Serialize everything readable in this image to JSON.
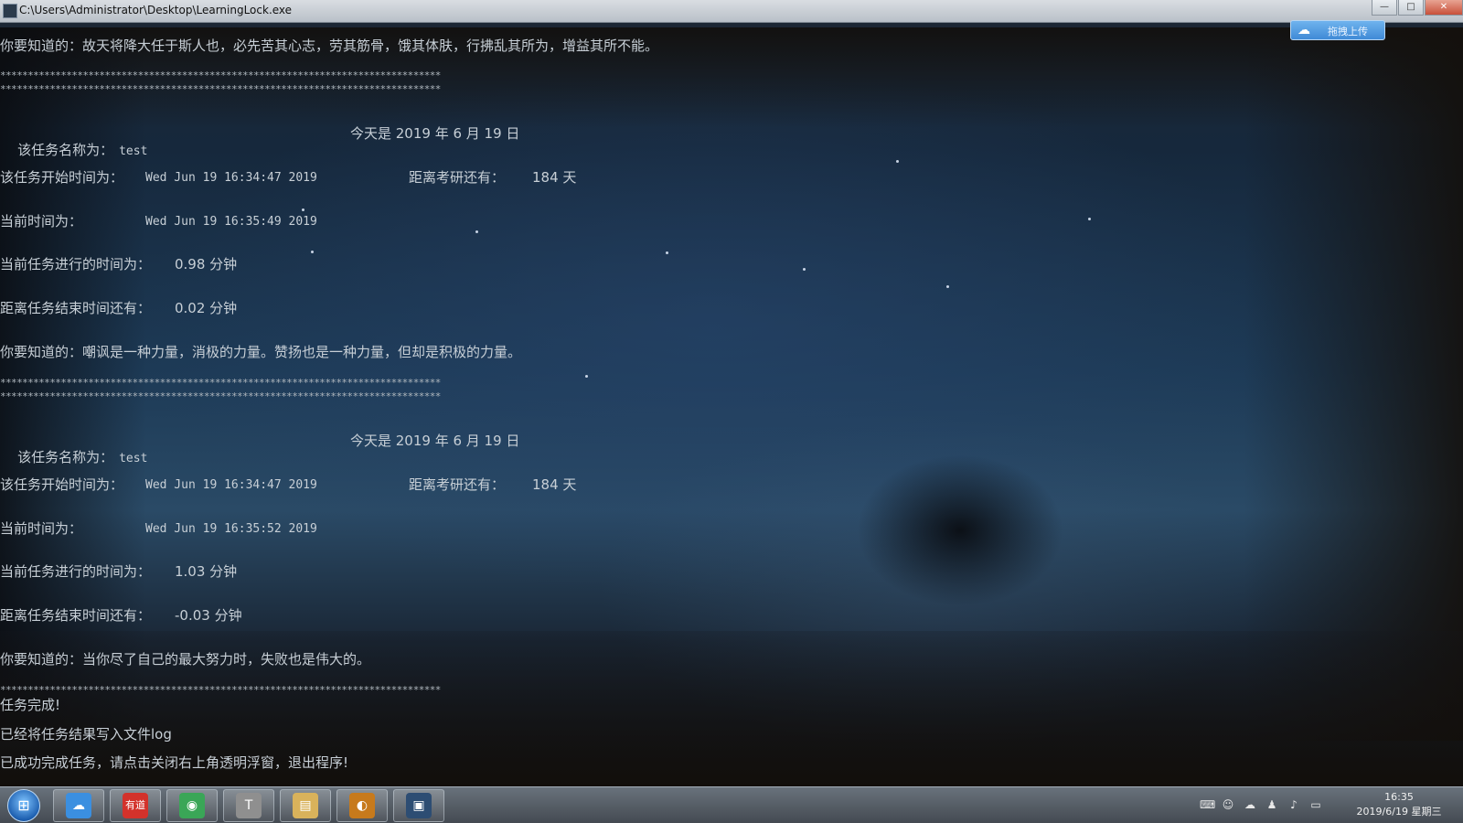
{
  "window": {
    "title": "C:\\Users\\Administrator\\Desktop\\LearningLock.exe",
    "buttons": {
      "minimize": "—",
      "maximize": "□",
      "close": "✕"
    }
  },
  "upload_widget": {
    "label": "拖拽上传",
    "icon": "cloud-icon"
  },
  "console": {
    "motto1": "你要知道的：故天将降大任于斯人也，必先苦其心志，劳其筋骨，饿其体肤，行拂乱其所为，增益其所不能。",
    "stars": "********************************************************************************",
    "block1": {
      "task_name_label": "该任务名称为：",
      "task_name": "test",
      "today_label": "今天是 2019 年 6 月 19 日",
      "start_label": "该任务开始时间为：",
      "start_value": "Wed Jun 19 16:34:47 2019",
      "exam_label": "距离考研还有：",
      "exam_value": "184 天",
      "now_label": "当前时间为：",
      "now_value": "Wed Jun 19 16:35:49 2019",
      "elapsed_label": "当前任务进行的时间为：",
      "elapsed_value": "0.98 分钟",
      "remaining_label": "距离任务结束时间还有：",
      "remaining_value": "0.02 分钟"
    },
    "motto2": "你要知道的：嘲讽是一种力量，消极的力量。赞扬也是一种力量，但却是积极的力量。",
    "block2": {
      "task_name_label": "该任务名称为：",
      "task_name": "test",
      "today_label": "今天是 2019 年 6 月 19 日",
      "start_label": "该任务开始时间为：",
      "start_value": "Wed Jun 19 16:34:47 2019",
      "exam_label": "距离考研还有：",
      "exam_value": "184 天",
      "now_label": "当前时间为：",
      "now_value": "Wed Jun 19 16:35:52 2019",
      "elapsed_label": "当前任务进行的时间为：",
      "elapsed_value": "1.03 分钟",
      "remaining_label": "距离任务结束时间还有：",
      "remaining_value": "-0.03 分钟"
    },
    "motto3": "你要知道的：当你尽了自己的最大努力时，失败也是伟大的。",
    "done": "任务完成!",
    "log_written": "已经将任务结果写入文件log",
    "exit_hint": "已成功完成任务，请点击关闭右上角透明浮窗，退出程序!"
  },
  "taskbar": {
    "start": "windows-start-icon",
    "apps": [
      {
        "name": "baidu-netdisk-icon",
        "glyph": "☁",
        "color": "#3b8fe0"
      },
      {
        "name": "youdao-icon",
        "glyph": "有道",
        "color": "#d3322b"
      },
      {
        "name": "chrome-icon",
        "glyph": "◉",
        "color": "#3aa657"
      },
      {
        "name": "text-editor-icon",
        "glyph": "T",
        "color": "#8f8f8f"
      },
      {
        "name": "file-explorer-icon",
        "glyph": "▤",
        "color": "#d9b25b"
      },
      {
        "name": "media-player-icon",
        "glyph": "◐",
        "color": "#c77a1c"
      },
      {
        "name": "learninglock-app-icon",
        "glyph": "▣",
        "color": "#2d4d73"
      }
    ],
    "clock_time": "16:35",
    "clock_date": "2019/6/19 星期三"
  }
}
